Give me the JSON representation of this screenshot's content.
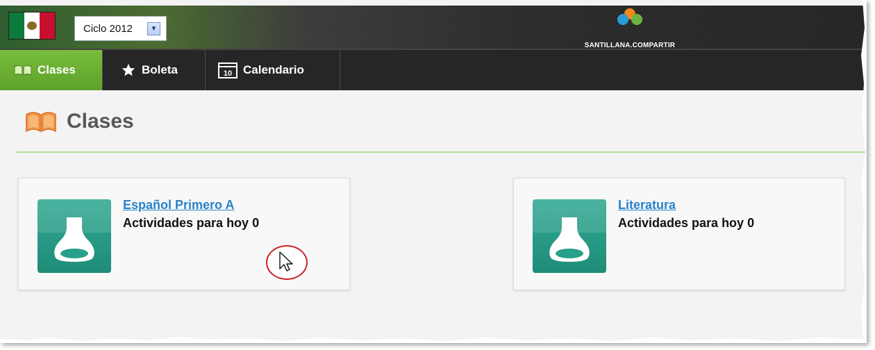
{
  "header": {
    "cycle_select": {
      "selected": "Ciclo 2012"
    },
    "brand_name": "SANTILLANA.COMPARTIR"
  },
  "nav": {
    "items": [
      {
        "label": "Clases",
        "icon": "book-icon",
        "active": true
      },
      {
        "label": "Boleta",
        "icon": "star-icon",
        "active": false
      },
      {
        "label": "Calendario",
        "icon": "calendar-icon",
        "active": false
      }
    ],
    "calendar_icon_number": "10"
  },
  "page": {
    "title": "Clases"
  },
  "classes": [
    {
      "name": "Español Primero A",
      "activities": "Actividades para hoy 0"
    },
    {
      "name": "Literatura",
      "activities": "Actividades para hoy 0"
    }
  ],
  "colors": {
    "nav_active": "#6aaf32",
    "card_icon": "#279d87",
    "link": "#2a82c8",
    "title_rule": "#b8dc94"
  }
}
